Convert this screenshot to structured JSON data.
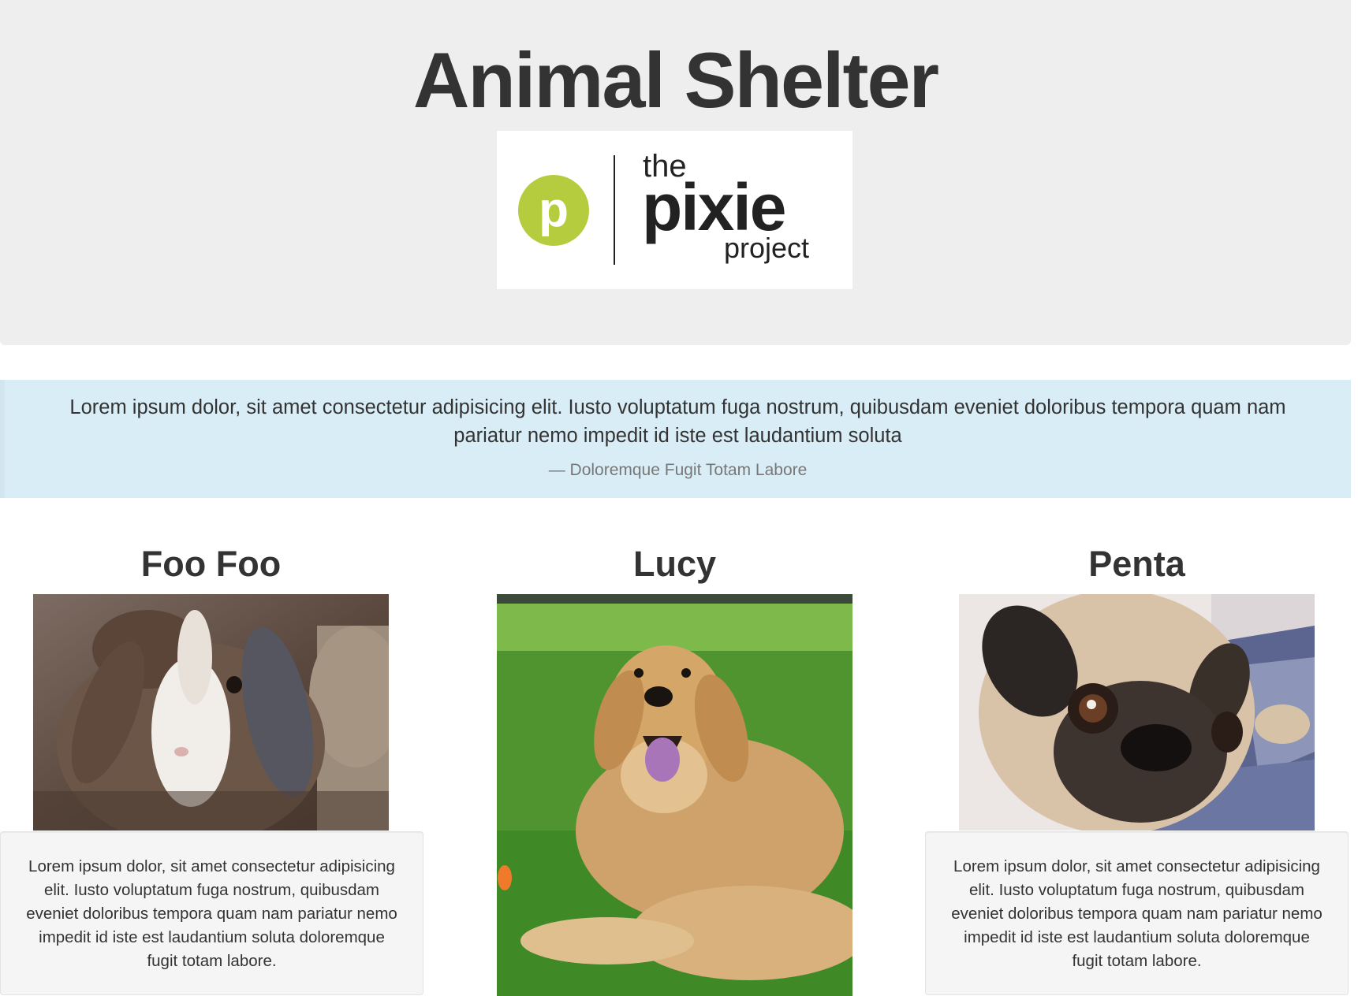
{
  "header": {
    "title": "Animal Shelter",
    "logo": {
      "word_the": "the",
      "word_pixie": "pixie",
      "word_project": "project",
      "mark_letter": "p",
      "accent_color": "#b5cc3f"
    }
  },
  "quote": {
    "text": "Lorem ipsum dolor, sit amet consectetur adipisicing elit. Iusto voluptatum fuga nostrum, quibusdam eveniet doloribus tempora quam nam pariatur nemo impedit id iste est laudantium soluta",
    "attribution": "— Doloremque Fugit Totam Labore"
  },
  "animals": [
    {
      "name": "Foo Foo",
      "photo_icon": "rabbit-photo",
      "description": "Lorem ipsum dolor, sit amet consectetur adipisicing elit. Iusto voluptatum fuga nostrum, quibusdam eveniet doloribus tempora quam nam pariatur nemo impedit id iste est laudantium soluta doloremque fugit totam labore."
    },
    {
      "name": "Lucy",
      "photo_icon": "golden-retriever-photo",
      "description": ""
    },
    {
      "name": "Penta",
      "photo_icon": "pug-photo",
      "description": "Lorem ipsum dolor, sit amet consectetur adipisicing elit. Iusto voluptatum fuga nostrum, quibusdam eveniet doloribus tempora quam nam pariatur nemo impedit id iste est laudantium soluta doloremque fugit totam labore."
    }
  ]
}
